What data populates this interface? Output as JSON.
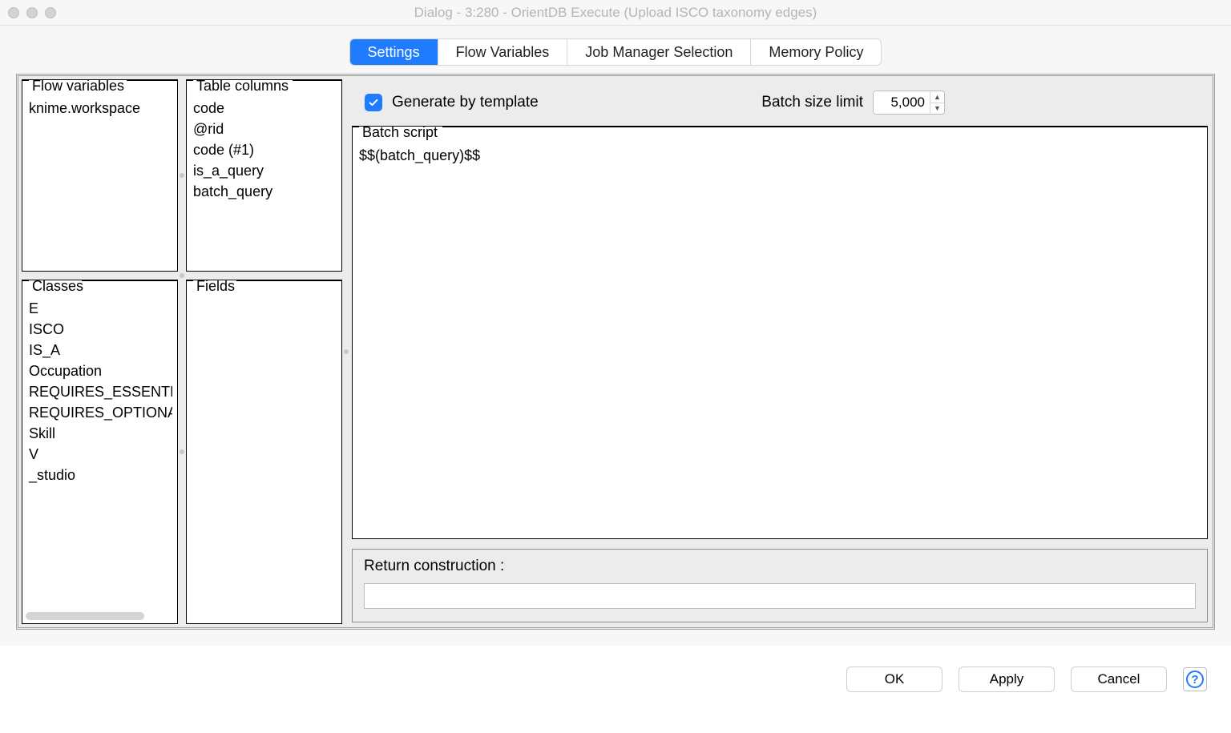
{
  "window": {
    "title": "Dialog - 3:280 - OrientDB Execute (Upload ISCO taxonomy edges)"
  },
  "tabs": [
    {
      "label": "Settings",
      "active": true
    },
    {
      "label": "Flow Variables",
      "active": false
    },
    {
      "label": "Job Manager Selection",
      "active": false
    },
    {
      "label": "Memory Policy",
      "active": false
    }
  ],
  "panels": {
    "flow_variables": {
      "title": "Flow variables",
      "items": [
        "knime.workspace"
      ]
    },
    "table_columns": {
      "title": "Table columns",
      "items": [
        "code",
        "@rid",
        "code (#1)",
        "is_a_query",
        "batch_query"
      ]
    },
    "classes": {
      "title": "Classes",
      "items": [
        "E",
        "ISCO",
        "IS_A",
        "Occupation",
        "REQUIRES_ESSENTIAL",
        "REQUIRES_OPTIONAL",
        "Skill",
        "V",
        "_studio"
      ]
    },
    "fields": {
      "title": "Fields",
      "items": []
    }
  },
  "settings": {
    "generate_by_template": {
      "label": "Generate by template",
      "checked": true
    },
    "batch_size_limit": {
      "label": "Batch size limit",
      "value": "5,000"
    },
    "batch_script": {
      "title": "Batch script",
      "content": "$$(batch_query)$$"
    },
    "return_construction": {
      "label": "Return construction :",
      "value": ""
    }
  },
  "footer": {
    "ok": "OK",
    "apply": "Apply",
    "cancel": "Cancel"
  }
}
